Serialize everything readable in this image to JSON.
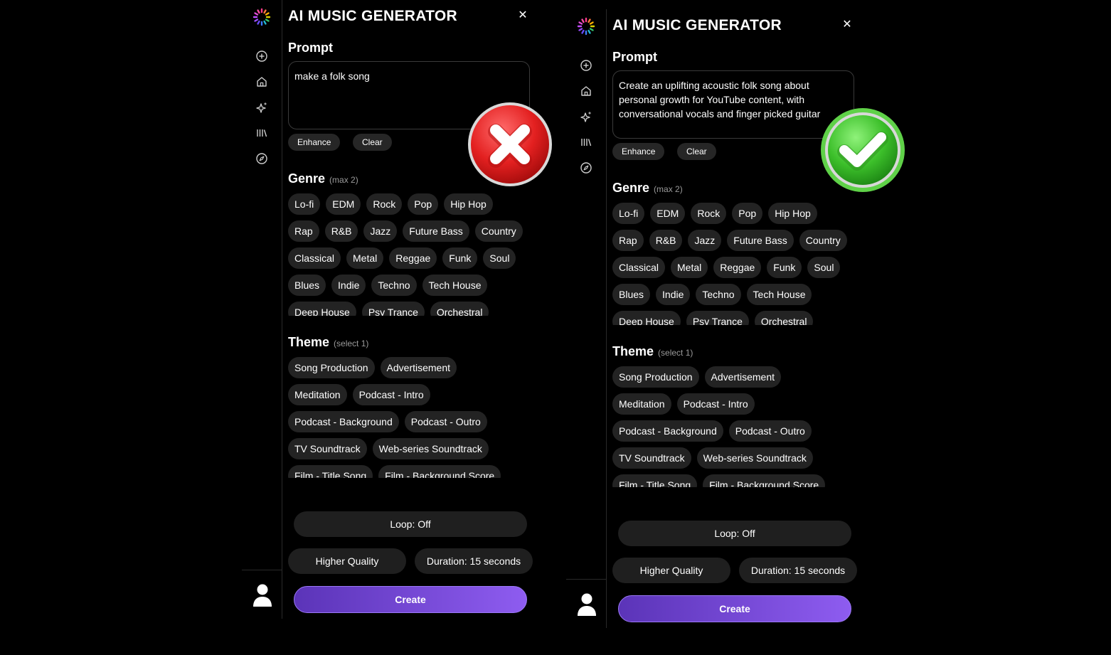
{
  "panels": [
    {
      "app_title": "AI MUSIC GENERATOR",
      "close_icon": "close-icon",
      "prompt": {
        "label": "Prompt",
        "value": "make a folk song",
        "enhance_label": "Enhance",
        "clear_label": "Clear"
      },
      "genre": {
        "label": "Genre",
        "hint": "(max 2)",
        "rows": [
          [
            "Lo-fi",
            "EDM",
            "Rock",
            "Pop",
            "Hip Hop"
          ],
          [
            "Rap",
            "R&B",
            "Jazz",
            "Future Bass",
            "Country"
          ],
          [
            "Classical",
            "Metal",
            "Reggae",
            "Funk",
            "Soul"
          ],
          [
            "Blues",
            "Indie",
            "Techno",
            "Tech House"
          ],
          [
            "Deep House",
            "Psy Trance",
            "Orchestral"
          ]
        ]
      },
      "theme": {
        "label": "Theme",
        "hint": "(select 1)",
        "rows": [
          [
            "Song Production",
            "Advertisement"
          ],
          [
            "Meditation",
            "Podcast - Intro"
          ],
          [
            "Podcast - Background",
            "Podcast - Outro"
          ],
          [
            "TV Soundtrack",
            "Web-series Soundtrack"
          ],
          [
            "Film - Title Song",
            "Film - Background Score"
          ]
        ]
      },
      "loop_label": "Loop: Off",
      "quality_label": "Higher Quality",
      "duration_label": "Duration: 15 seconds",
      "create_label": "Create",
      "badge": {
        "type": "cross",
        "icon": "red-cross-icon"
      }
    },
    {
      "app_title": "AI MUSIC GENERATOR",
      "close_icon": "close-icon",
      "prompt": {
        "label": "Prompt",
        "value": "Create an uplifting acoustic folk song about personal growth for YouTube content, with conversational vocals and finger picked guitar",
        "enhance_label": "Enhance",
        "clear_label": "Clear"
      },
      "genre": {
        "label": "Genre",
        "hint": "(max 2)",
        "rows": [
          [
            "Lo-fi",
            "EDM",
            "Rock",
            "Pop",
            "Hip Hop"
          ],
          [
            "Rap",
            "R&B",
            "Jazz",
            "Future Bass",
            "Country"
          ],
          [
            "Classical",
            "Metal",
            "Reggae",
            "Funk",
            "Soul"
          ],
          [
            "Blues",
            "Indie",
            "Techno",
            "Tech House"
          ],
          [
            "Deep House",
            "Psy Trance",
            "Orchestral"
          ]
        ]
      },
      "theme": {
        "label": "Theme",
        "hint": "(select 1)",
        "rows": [
          [
            "Song Production",
            "Advertisement"
          ],
          [
            "Meditation",
            "Podcast - Intro"
          ],
          [
            "Podcast - Background",
            "Podcast - Outro"
          ],
          [
            "TV Soundtrack",
            "Web-series Soundtrack"
          ],
          [
            "Film - Title Song",
            "Film - Background Score"
          ]
        ]
      },
      "loop_label": "Loop: Off",
      "quality_label": "Higher Quality",
      "duration_label": "Duration: 15 seconds",
      "create_label": "Create",
      "badge": {
        "type": "check",
        "icon": "green-check-icon"
      }
    }
  ],
  "rail_icons": [
    "logo-icon",
    "plus-circle-icon",
    "home-icon",
    "sparkle-icon",
    "library-icon",
    "compass-icon",
    "user-avatar-icon"
  ],
  "colors": {
    "background": "#000000",
    "chip": "#232323",
    "create_gradient_start": "#5b34b8",
    "create_gradient_end": "#8e5cf0",
    "error": "#e02424",
    "success": "#3cbf2a"
  }
}
